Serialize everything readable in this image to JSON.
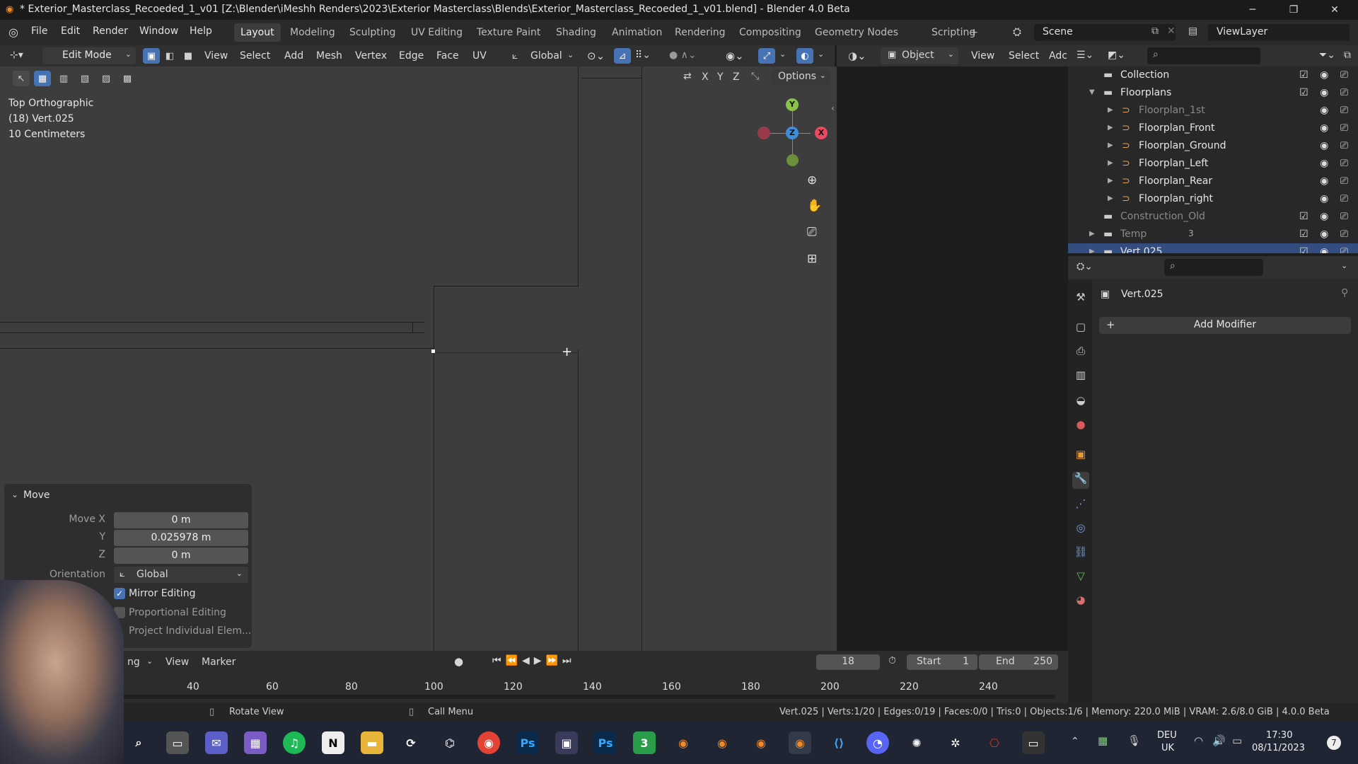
{
  "window": {
    "title": "* Exterior_Masterclass_Recoeded_1_v01 [Z:\\Blender\\iMeshh Renders\\2023\\Exterior Masterclass\\Blends\\Exterior_Masterclass_Recoeded_1_v01.blend] - Blender 4.0 Beta"
  },
  "menu": [
    "File",
    "Edit",
    "Render",
    "Window",
    "Help"
  ],
  "workspaces": [
    "Layout",
    "Modeling",
    "Sculpting",
    "UV Editing",
    "Texture Paint",
    "Shading",
    "Animation",
    "Rendering",
    "Compositing",
    "Geometry Nodes",
    "Scripting",
    "+"
  ],
  "scene": {
    "label": "Scene"
  },
  "viewlayer": {
    "label": "ViewLayer"
  },
  "vp_header": {
    "mode": "Edit Mode",
    "menus": [
      "View",
      "Select",
      "Add",
      "Mesh",
      "Vertex",
      "Edge",
      "Face",
      "UV"
    ],
    "orientation": "Global",
    "shading_object": "Object",
    "menus2": [
      "View",
      "Select",
      "Adc"
    ],
    "options": "Options",
    "axes": [
      "X",
      "Y",
      "Z"
    ]
  },
  "viewport": {
    "view_name": "Top Orthographic",
    "object_info": "(18) Vert.025",
    "scale": "10 Centimeters",
    "gizmo": {
      "y": "Y",
      "z": "Z",
      "x": "X"
    }
  },
  "move_panel": {
    "title": "Move",
    "move_x_label": "Move X",
    "move_x": "0 m",
    "y_label": "Y",
    "y": "0.025978 m",
    "z_label": "Z",
    "z": "0 m",
    "orientation_label": "Orientation",
    "orientation": "Global",
    "mirror_editing": "Mirror Editing",
    "proportional_editing": "Proportional Editing",
    "project_individual": "Project Individual Elem..."
  },
  "outliner": {
    "rows": [
      {
        "name": "Collection",
        "indent": 0
      },
      {
        "name": "Floorplans",
        "indent": 0
      },
      {
        "name": "Floorplan_1st",
        "indent": 1,
        "dim": true
      },
      {
        "name": "Floorplan_Front",
        "indent": 1
      },
      {
        "name": "Floorplan_Ground",
        "indent": 1
      },
      {
        "name": "Floorplan_Left",
        "indent": 1
      },
      {
        "name": "Floorplan_Rear",
        "indent": 1
      },
      {
        "name": "Floorplan_right",
        "indent": 1
      },
      {
        "name": "Construction_Old",
        "indent": 0,
        "dim": true
      },
      {
        "name": "Temp",
        "indent": 0,
        "dim": true
      },
      {
        "name": "Vert.025",
        "indent": 0,
        "selected": true
      }
    ],
    "temp_badge": "3"
  },
  "properties": {
    "object_name": "Vert.025",
    "add_modifier": "Add Modifier"
  },
  "timeline": {
    "menus": [
      "ng",
      "View",
      "Marker"
    ],
    "current_frame": "18",
    "start_label": "Start",
    "start": "1",
    "end_label": "End",
    "end": "250",
    "ruler": [
      "40",
      "60",
      "80",
      "100",
      "120",
      "140",
      "160",
      "180",
      "200",
      "220",
      "240"
    ]
  },
  "status": {
    "rotate_view": "Rotate View",
    "call_menu": "Call Menu",
    "stats": "Vert.025 | Verts:1/20 | Edges:0/19 | Faces:0/0 | Tris:0 | Objects:1/6 | Memory: 220.0 MiB | VRAM: 2.6/8.0 GiB | 4.0.0 Beta"
  },
  "taskbar": {
    "lang": "DEU",
    "region": "UK",
    "time": "17:30",
    "date": "08/11/2023",
    "notif": "7"
  },
  "colors": {
    "accent": "#4772b3",
    "viewport_bg": "#3d3d3d",
    "gizmo_x": "#e84a5f",
    "gizmo_y": "#8bc34a",
    "gizmo_z": "#3d8edb"
  }
}
